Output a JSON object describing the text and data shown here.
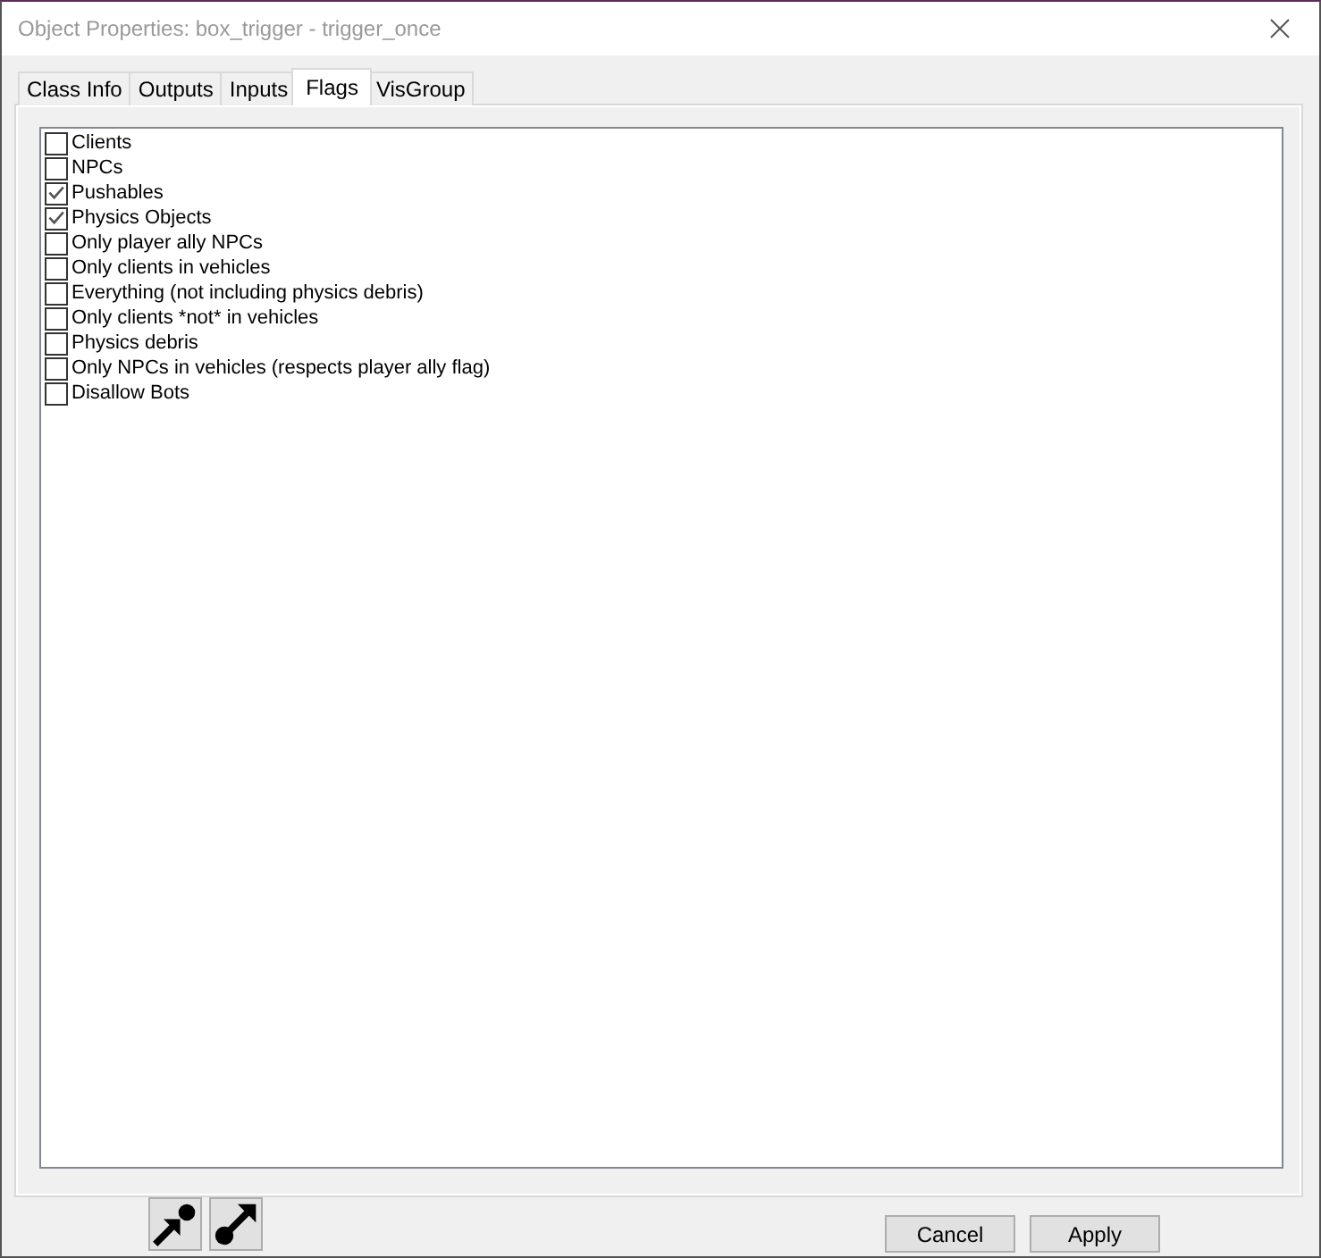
{
  "window": {
    "title": "Object Properties: box_trigger - trigger_once"
  },
  "tabs": [
    {
      "label": "Class Info",
      "selected": false
    },
    {
      "label": "Outputs",
      "selected": false
    },
    {
      "label": "Inputs",
      "selected": false
    },
    {
      "label": "Flags",
      "selected": true
    },
    {
      "label": "VisGroup",
      "selected": false
    }
  ],
  "flags": [
    {
      "label": "Clients",
      "checked": false
    },
    {
      "label": "NPCs",
      "checked": false
    },
    {
      "label": "Pushables",
      "checked": true
    },
    {
      "label": "Physics Objects",
      "checked": true
    },
    {
      "label": "Only player ally NPCs",
      "checked": false
    },
    {
      "label": "Only clients in vehicles",
      "checked": false
    },
    {
      "label": "Everything (not including physics debris)",
      "checked": false
    },
    {
      "label": "Only clients *not* in vehicles",
      "checked": false
    },
    {
      "label": "Physics debris",
      "checked": false
    },
    {
      "label": "Only NPCs in vehicles (respects player ally flag)",
      "checked": false
    },
    {
      "label": "Disallow Bots",
      "checked": false
    }
  ],
  "buttons": [
    {
      "label": "Cancel"
    },
    {
      "label": "Apply"
    }
  ]
}
